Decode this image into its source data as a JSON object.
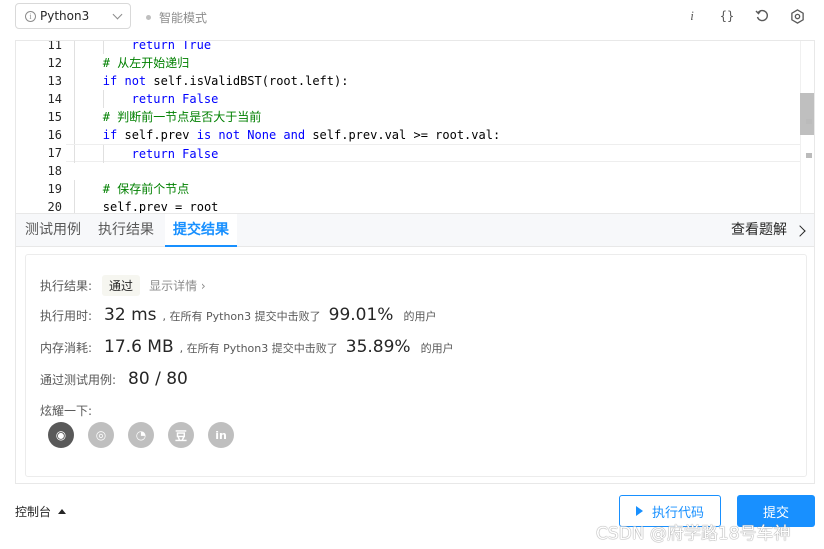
{
  "toolbar": {
    "language": "Python3",
    "mode": "智能模式",
    "icons": [
      "info-icon",
      "braces-icon",
      "reset-icon",
      "settings-icon"
    ]
  },
  "editor": {
    "lines": [
      {
        "no": "11",
        "indent": 2,
        "tokens": [
          {
            "t": "kw",
            "v": "return "
          },
          {
            "t": "kw",
            "v": "True"
          }
        ]
      },
      {
        "no": "12",
        "indent": 1,
        "tokens": [
          {
            "t": "cm",
            "v": "# 从左开始递归"
          }
        ]
      },
      {
        "no": "13",
        "indent": 1,
        "tokens": [
          {
            "t": "kw",
            "v": "if not "
          },
          {
            "t": "tx",
            "v": "self.isValidBST(root.left):"
          }
        ]
      },
      {
        "no": "14",
        "indent": 2,
        "tokens": [
          {
            "t": "kw",
            "v": "return "
          },
          {
            "t": "kw",
            "v": "False"
          }
        ]
      },
      {
        "no": "15",
        "indent": 1,
        "tokens": [
          {
            "t": "cm",
            "v": "# 判断前一节点是否大于当前"
          }
        ]
      },
      {
        "no": "16",
        "indent": 1,
        "tokens": [
          {
            "t": "kw",
            "v": "if "
          },
          {
            "t": "tx",
            "v": "self.prev "
          },
          {
            "t": "kw",
            "v": "is not None and "
          },
          {
            "t": "tx",
            "v": "self.prev.val >= root.val:"
          }
        ]
      },
      {
        "no": "17",
        "indent": 2,
        "active": true,
        "tokens": [
          {
            "t": "kw",
            "v": "return "
          },
          {
            "t": "kw",
            "v": "False"
          }
        ]
      },
      {
        "no": "18",
        "indent": 0,
        "tokens": []
      },
      {
        "no": "19",
        "indent": 1,
        "tokens": [
          {
            "t": "cm",
            "v": "# 保存前个节点"
          }
        ]
      },
      {
        "no": "20",
        "indent": 1,
        "tokens": [
          {
            "t": "tx",
            "v": "self.prev = root"
          }
        ]
      }
    ]
  },
  "tabs": {
    "items": [
      "测试用例",
      "执行结果",
      "提交结果"
    ],
    "active": 2,
    "solution_link": "查看题解"
  },
  "result": {
    "status_label": "执行结果:",
    "status": "通过",
    "details_link": "显示详情",
    "time_label": "执行用时:",
    "time_value": "32 ms",
    "time_desc": ", 在所有 Python3 提交中击败了",
    "time_percent": "99.01%",
    "time_suffix": "的用户",
    "mem_label": "内存消耗:",
    "mem_value": "17.6 MB",
    "mem_desc": ", 在所有 Python3 提交中击败了",
    "mem_percent": "35.89%",
    "mem_suffix": "的用户",
    "tests_label": "通过测试用例:",
    "tests_value": "80 / 80",
    "share_label": "炫耀一下:",
    "share_icons": [
      "wechat-icon",
      "weibo-icon",
      "qq-icon",
      "douban-icon",
      "linkedin-icon"
    ],
    "share_glyphs": [
      "◉",
      "◎",
      "◔",
      "豆",
      "in"
    ]
  },
  "footer": {
    "console": "控制台",
    "run": "执行代码",
    "submit": "提交"
  },
  "watermark": "CSDN @府学路18号车神"
}
